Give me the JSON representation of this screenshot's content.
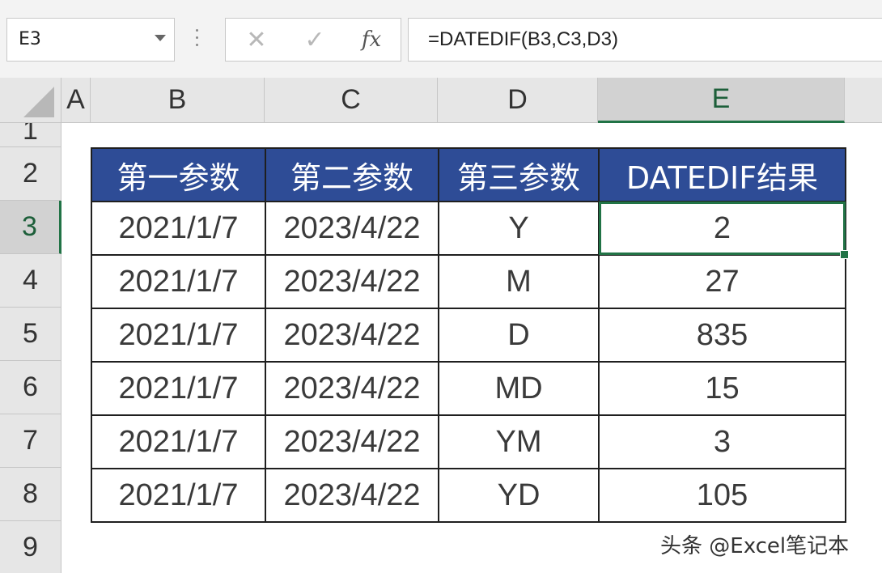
{
  "name_box": "E3",
  "formula_bar": {
    "cancel_icon": "close-icon",
    "enter_icon": "check-icon",
    "fx_label": "fx",
    "formula": "=DATEDIF(B3,C3,D3)"
  },
  "columns": [
    "A",
    "B",
    "C",
    "D",
    "E"
  ],
  "rows": [
    "1",
    "2",
    "3",
    "4",
    "5",
    "6",
    "7",
    "8",
    "9"
  ],
  "selected": {
    "column": "E",
    "row": "3"
  },
  "table": {
    "headers": [
      "第一参数",
      "第二参数",
      "第三参数",
      "DATEDIF结果"
    ],
    "rows": [
      [
        "2021/1/7",
        "2023/4/22",
        "Y",
        "2"
      ],
      [
        "2021/1/7",
        "2023/4/22",
        "M",
        "27"
      ],
      [
        "2021/1/7",
        "2023/4/22",
        "D",
        "835"
      ],
      [
        "2021/1/7",
        "2023/4/22",
        "MD",
        "15"
      ],
      [
        "2021/1/7",
        "2023/4/22",
        "YM",
        "3"
      ],
      [
        "2021/1/7",
        "2023/4/22",
        "YD",
        "105"
      ]
    ]
  },
  "watermark": "头条 @Excel笔记本",
  "colors": {
    "header_fill": "#2e4c96",
    "selection": "#217346"
  }
}
